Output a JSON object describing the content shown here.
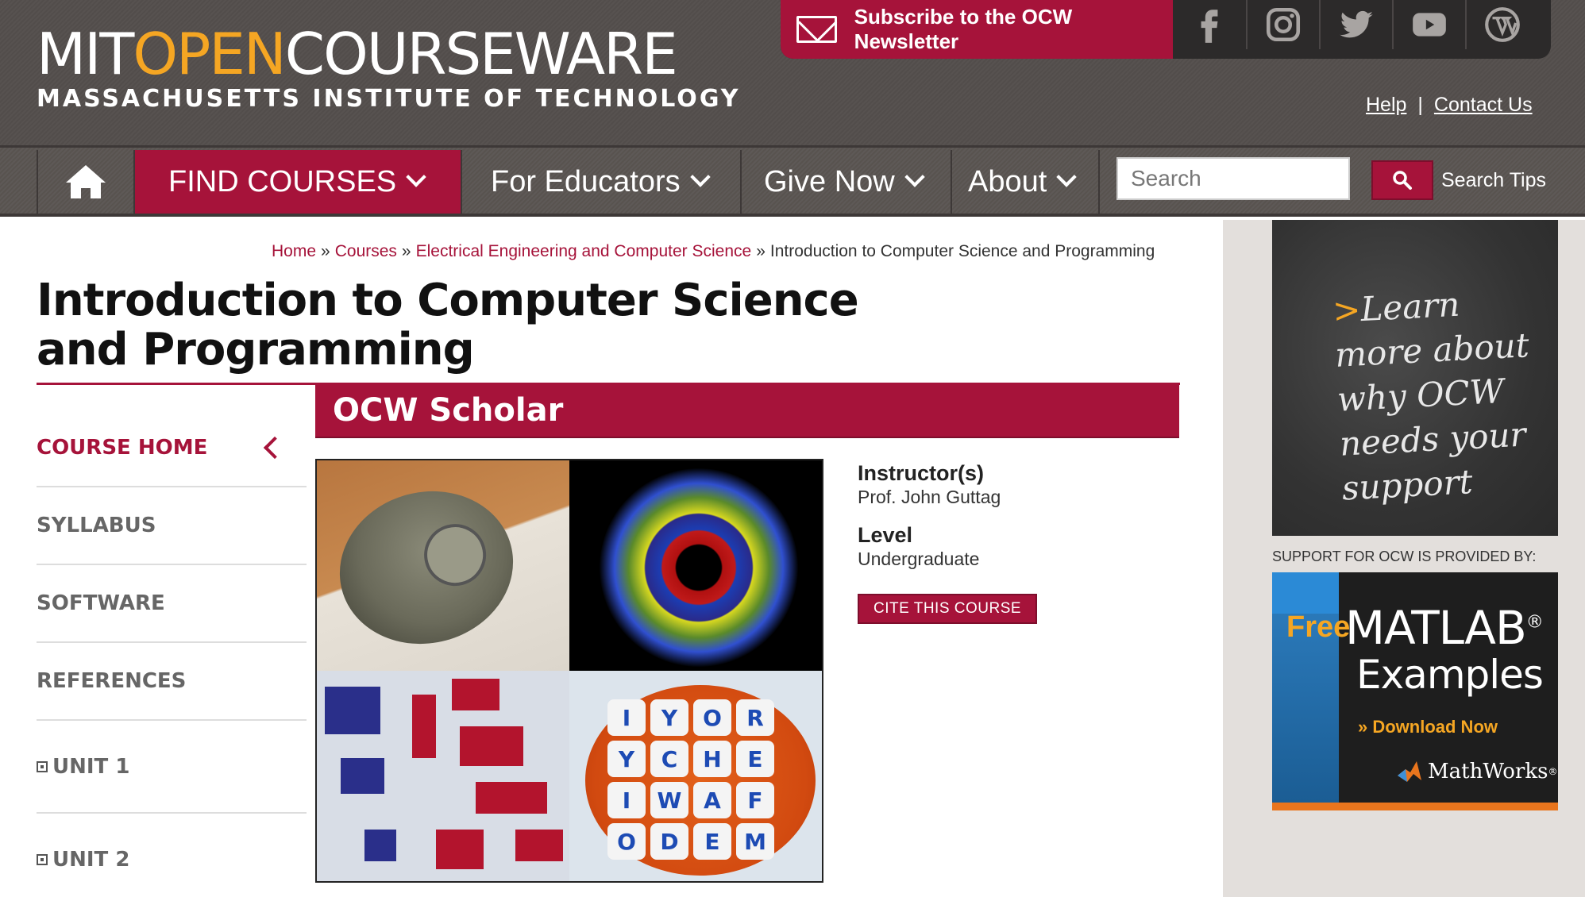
{
  "header": {
    "logo": {
      "mit": "MIT",
      "open": "OPEN",
      "courseware": "COURSEWARE"
    },
    "tagline": "MASSACHUSETTS INSTITUTE OF TECHNOLOGY",
    "newsletter_label": "Subscribe to the OCW Newsletter",
    "social": [
      "facebook-icon",
      "instagram-icon",
      "twitter-icon",
      "youtube-icon",
      "wordpress-icon"
    ],
    "help_label": "Help",
    "separator": "|",
    "contact_label": "Contact Us"
  },
  "nav": {
    "home_icon": "home-icon",
    "items": [
      {
        "label": "FIND COURSES"
      },
      {
        "label": "For Educators"
      },
      {
        "label": "Give Now"
      },
      {
        "label": "About"
      }
    ],
    "search": {
      "placeholder": "Search",
      "value": ""
    },
    "search_tips": "Search Tips"
  },
  "breadcrumb": {
    "items": [
      "Home",
      "Courses",
      "Electrical Engineering and Computer Science"
    ],
    "current": "Introduction to Computer Science and Programming",
    "separator": "»"
  },
  "course": {
    "title": "Introduction to Computer Science and Programming",
    "banner": "OCW Scholar",
    "instructor_label": "Instructor(s)",
    "instructor": "Prof. John Guttag",
    "level_label": "Level",
    "level": "Undergraduate",
    "cite_label": "CITE THIS COURSE",
    "image_letters": [
      "I",
      "Y",
      "O",
      "R",
      "Y",
      "C",
      "H",
      "E",
      "I",
      "W",
      "A",
      "F",
      "O",
      "D",
      "E",
      "M"
    ]
  },
  "leftnav": {
    "items": [
      {
        "label": "COURSE HOME"
      },
      {
        "label": "SYLLABUS"
      },
      {
        "label": "SOFTWARE"
      },
      {
        "label": "REFERENCES"
      },
      {
        "label": "UNIT 1"
      },
      {
        "label": "UNIT 2"
      }
    ]
  },
  "sidebar": {
    "promo_arrow": ">",
    "promo_text": "Learn more about why OCW needs your support",
    "support_label": "SUPPORT FOR OCW IS PROVIDED BY:",
    "ad": {
      "free": "Free",
      "title1": "MATLAB",
      "reg": "®",
      "title2": "Examples",
      "cta": "» Download Now",
      "brand": "MathWorks",
      "reg2": "®"
    }
  },
  "colors": {
    "brand_red": "#a6133a",
    "accent_orange": "#f5a623",
    "header_gray": "#575250"
  }
}
